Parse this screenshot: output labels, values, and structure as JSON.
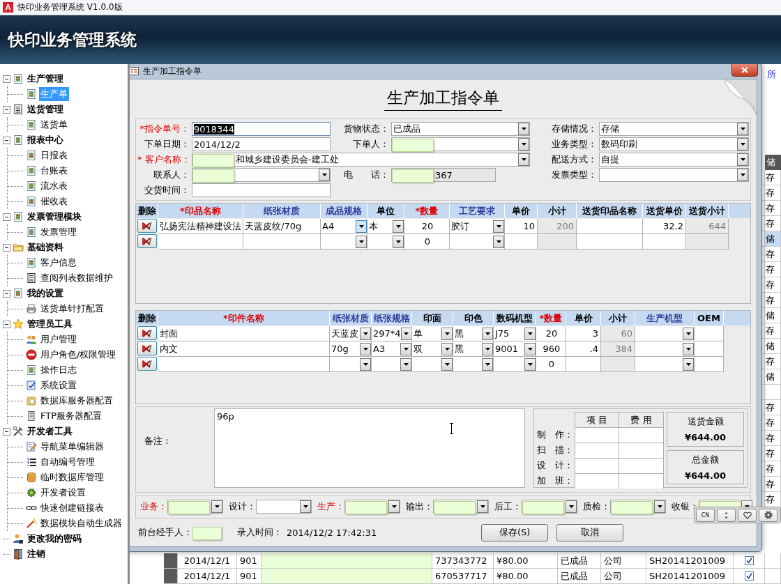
{
  "window": {
    "app_icon": "A",
    "title": "快印业务管理系统 V1.0.0版"
  },
  "banner": {
    "title": "快印业务管理系统"
  },
  "sidebar": {
    "items": [
      {
        "label": "生产管理",
        "kind": "doc",
        "selected": false,
        "expanded": true,
        "children": [
          {
            "label": "生产单",
            "kind": "doc",
            "selected": true
          }
        ]
      },
      {
        "label": "送货管理",
        "kind": "list",
        "selected": false,
        "expanded": true,
        "children": [
          {
            "label": "送货单",
            "kind": "doc",
            "selected": false
          }
        ]
      },
      {
        "label": "报表中心",
        "kind": "doc",
        "selected": false,
        "expanded": true,
        "children": [
          {
            "label": "日报表",
            "kind": "doc",
            "selected": false
          },
          {
            "label": "台账表",
            "kind": "doc",
            "selected": false
          },
          {
            "label": "流水表",
            "kind": "doc",
            "selected": false
          },
          {
            "label": "催收表",
            "kind": "doc",
            "selected": false
          }
        ]
      },
      {
        "label": "发票管理模块",
        "kind": "doc",
        "selected": false,
        "expanded": true,
        "children": [
          {
            "label": "发票管理",
            "kind": "doc",
            "selected": false
          }
        ]
      },
      {
        "label": "基础资料",
        "kind": "folder",
        "selected": false,
        "expanded": true,
        "children": [
          {
            "label": "客户信息",
            "kind": "doc",
            "selected": false
          },
          {
            "label": "查阅列表数据维护",
            "kind": "list",
            "selected": false
          }
        ]
      },
      {
        "label": "我的设置",
        "kind": "doc",
        "selected": false,
        "expanded": true,
        "children": [
          {
            "label": "送货单针打配置",
            "kind": "printer",
            "selected": false
          }
        ]
      },
      {
        "label": "管理员工具",
        "kind": "star",
        "selected": false,
        "expanded": true,
        "children": [
          {
            "label": "用户管理",
            "kind": "users",
            "selected": false
          },
          {
            "label": "用户角色/权限管理",
            "kind": "stop",
            "selected": false
          },
          {
            "label": "操作日志",
            "kind": "doc",
            "selected": false
          },
          {
            "label": "系统设置",
            "kind": "settings",
            "selected": false
          },
          {
            "label": "数据库服务器配置",
            "kind": "database",
            "selected": false
          },
          {
            "label": "FTP服务器配置",
            "kind": "server",
            "selected": false
          }
        ]
      },
      {
        "label": "开发者工具",
        "kind": "tools",
        "selected": false,
        "expanded": true,
        "children": [
          {
            "label": "导航菜单编辑器",
            "kind": "edit",
            "selected": false
          },
          {
            "label": "自动编号管理",
            "kind": "numbering",
            "selected": false
          },
          {
            "label": "临时数据库管理",
            "kind": "db",
            "selected": false
          },
          {
            "label": "开发者设置",
            "kind": "gear",
            "selected": false
          },
          {
            "label": "快速创建链接表",
            "kind": "link",
            "selected": false
          },
          {
            "label": "数据模块自动生成器",
            "kind": "wand",
            "selected": false
          }
        ]
      },
      {
        "label": "更改我的密码",
        "kind": "user",
        "selected": false
      },
      {
        "label": "注销",
        "kind": "exit",
        "selected": false
      }
    ]
  },
  "background": {
    "link": "所",
    "header": "储",
    "rows": [
      {
        "storage": "存",
        "selected": false
      },
      {
        "storage": "存",
        "selected": false
      },
      {
        "storage": "存",
        "selected": false
      },
      {
        "storage": "存",
        "selected": false
      },
      {
        "storage": "储",
        "selected": true
      },
      {
        "storage": "存",
        "selected": false
      },
      {
        "storage": "存",
        "selected": false
      },
      {
        "storage": "存",
        "selected": false
      },
      {
        "storage": "存",
        "selected": false
      },
      {
        "storage": "储",
        "selected": false
      },
      {
        "storage": "存",
        "selected": false
      },
      {
        "storage": "储",
        "selected": false
      },
      {
        "storage": "存",
        "selected": false
      },
      {
        "storage": "储",
        "selected": false
      },
      {
        "selected": false
      },
      {
        "storage": "存",
        "selected": false
      },
      {
        "storage": "存",
        "selected": false
      },
      {
        "storage": "存",
        "selected": false
      },
      {
        "storage": "存",
        "selected": false
      },
      {
        "storage": "存",
        "selected": false
      },
      {
        "storage": "存",
        "selected": false
      },
      {
        "storage": "存",
        "selected": false
      },
      {
        "selected": false,
        "date": "2014/12/1",
        "number": "901",
        "redacted": true,
        "phone": "737343772",
        "amount": "¥80.00",
        "status": "已成品",
        "category": "公司",
        "delivery_no": "SH20141201009",
        "checked": true
      },
      {
        "selected": false,
        "date": "2014/12/1",
        "number": "901",
        "redacted": true,
        "phone": "670537717",
        "amount": "¥80.00",
        "status": "已成品",
        "category": "公司",
        "delivery_no": "SH20141201009",
        "checked": true
      }
    ]
  },
  "dialog": {
    "title": "生产加工指令单",
    "heading": "生产加工指令单",
    "form": {
      "rows": [
        [
          {
            "label": "*指令单号：",
            "required": true,
            "kind": "text",
            "value": "9018344",
            "highlighted": true,
            "redacted": false
          },
          {
            "label": "货物状态：",
            "required": false,
            "kind": "combo",
            "value": "已成品",
            "highlighted": false,
            "redacted": false
          },
          {
            "label": "存储情况：",
            "required": false,
            "kind": "combo",
            "value": "存储",
            "highlighted": false,
            "redacted": false
          }
        ],
        [
          {
            "label": "下单日期：",
            "required": false,
            "kind": "text",
            "value": "2014/12/2",
            "highlighted": false,
            "redacted": false
          },
          {
            "label": "下单人：",
            "required": false,
            "kind": "combo",
            "highlighted": false,
            "redacted": true
          },
          {
            "label": "业务类型：",
            "required": false,
            "kind": "combo",
            "value": "数码印刷",
            "highlighted": false,
            "redacted": false
          }
        ],
        [
          {
            "label": "* 客户名称：",
            "required": true,
            "kind": "combo",
            "colspan": 2,
            "value": "和城乡建设委员会-建工处",
            "highlighted": false,
            "redacted": true
          },
          {
            "label": "配送方式：",
            "required": false,
            "kind": "combo",
            "value": "自提",
            "highlighted": false,
            "redacted": false
          }
        ],
        [
          {
            "label": "联系人：",
            "required": false,
            "kind": "combo",
            "highlighted": false,
            "redacted": true
          },
          {
            "label": "电　　话：",
            "required": false,
            "kind": "readonly",
            "value": "367",
            "highlighted": false,
            "redacted": true
          },
          {
            "label": "发票类型：",
            "required": false,
            "kind": "combo",
            "highlighted": false,
            "redacted": false
          }
        ],
        [
          {
            "label": "交货时间：",
            "required": false,
            "kind": "text",
            "highlighted": false,
            "redacted": false
          }
        ]
      ]
    },
    "products": {
      "columns": [
        {
          "label": "删除",
          "color": "#000000",
          "kind": "delete"
        },
        {
          "label": "*印品名称",
          "color": "#e00000",
          "kind": "text"
        },
        {
          "label": "纸张材质",
          "color": "#2b3c9c",
          "kind": "text"
        },
        {
          "label": "成品规格",
          "color": "#2b3c9c",
          "kind": "combo"
        },
        {
          "label": "单位",
          "color": "#000000",
          "kind": "combo"
        },
        {
          "label": "*数量",
          "color": "#e00000",
          "kind": "qty"
        },
        {
          "label": "工艺要求",
          "color": "#2b3c9c",
          "kind": "combo"
        },
        {
          "label": "单价",
          "color": "#000000",
          "kind": "num"
        },
        {
          "label": "小计",
          "color": "#000000",
          "kind": "calc"
        },
        {
          "label": "送货印品名称",
          "color": "#000000",
          "kind": "text"
        },
        {
          "label": "送货单价",
          "color": "#000000",
          "kind": "num"
        },
        {
          "label": "送货小计",
          "color": "#000000",
          "kind": "calc"
        }
      ],
      "rows": [
        {
          "cells": [
            null,
            "弘扬宪法精神建设法",
            "天蓝皮纹/70g",
            "A4",
            "本",
            "20",
            "胶订",
            "10",
            "200",
            null,
            "32.2",
            "644"
          ]
        },
        {
          "cells": [
            null,
            null,
            null,
            null,
            null,
            "0",
            null,
            null,
            null,
            null,
            null,
            null
          ]
        }
      ]
    },
    "parts": {
      "columns": [
        {
          "label": "删除",
          "color": "#000000",
          "kind": "delete"
        },
        {
          "label": "*印件名称",
          "color": "#e00000",
          "kind": "text"
        },
        {
          "label": "纸张材质",
          "color": "#2b3c9c",
          "kind": "combo"
        },
        {
          "label": "纸张规格",
          "color": "#2b3c9c",
          "kind": "combo"
        },
        {
          "label": "印面",
          "color": "#000000",
          "kind": "combo"
        },
        {
          "label": "印色",
          "color": "#000000",
          "kind": "combo"
        },
        {
          "label": "数码机型",
          "color": "#000000",
          "kind": "combo"
        },
        {
          "label": "*数量",
          "color": "#e00000",
          "kind": "qty"
        },
        {
          "label": "单价",
          "color": "#000000",
          "kind": "num"
        },
        {
          "label": "小计",
          "color": "#000000",
          "kind": "calc"
        },
        {
          "label": "生产机型",
          "color": "#2b3c9c",
          "kind": "combo"
        },
        {
          "label": "OEM",
          "color": "#000000",
          "kind": "text"
        }
      ],
      "rows": [
        {
          "cells": [
            null,
            "封面",
            "天蓝皮",
            "297*4",
            "单",
            "黑",
            "J75",
            "20",
            "3",
            "60",
            null,
            null
          ]
        },
        {
          "cells": [
            null,
            "内文",
            "70g",
            "A3",
            "双",
            "黑",
            "9001",
            "960",
            ".4",
            "384",
            null,
            null
          ]
        },
        {
          "cells": [
            null,
            null,
            null,
            null,
            null,
            null,
            null,
            "0",
            null,
            null,
            null,
            null
          ]
        }
      ]
    },
    "remarks": {
      "label": "备注：",
      "value": "96p"
    },
    "costs": {
      "headers": [
        "项 目",
        "费 用"
      ],
      "rows": [
        "制　作：",
        "扫　描：",
        "设　计：",
        "加　班："
      ]
    },
    "totals": [
      {
        "label": "送货金额",
        "value": "¥644.00"
      },
      {
        "label": "总金额",
        "value": "¥644.00"
      }
    ],
    "staff": [
      {
        "label": "业务：",
        "required": true,
        "redacted": true
      },
      {
        "label": "设计：",
        "required": false,
        "redacted": false
      },
      {
        "label": "生产：",
        "required": true,
        "redacted": true
      },
      {
        "label": "输出：",
        "required": false,
        "redacted": true
      },
      {
        "label": "后工：",
        "required": false,
        "redacted": true
      },
      {
        "label": "质检：",
        "required": false,
        "redacted": true
      },
      {
        "label": "收银：",
        "required": false,
        "redacted": true
      }
    ],
    "handler": {
      "label": "前台经手人：",
      "redacted": true
    },
    "entry_time": {
      "label": "录入时间：",
      "value": "2014/12/2 17:42:31"
    },
    "buttons": [
      "保存(S)",
      "取消"
    ]
  },
  "ime_toolbar": {
    "label": "CN"
  }
}
